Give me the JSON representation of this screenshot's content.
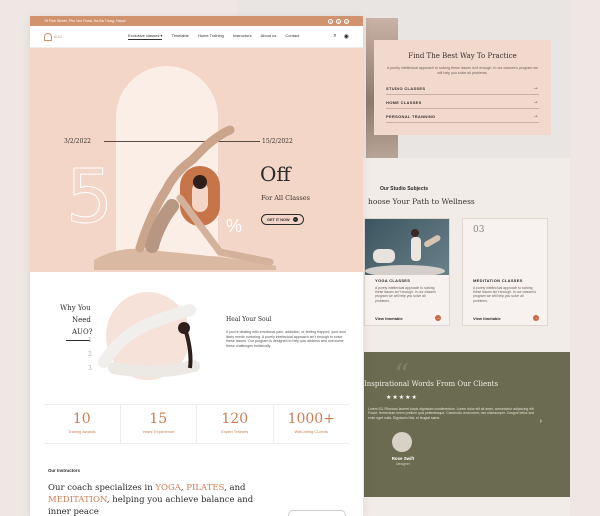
{
  "back": {
    "practice": {
      "title": "Find The Best Way To Practice",
      "text": "A purely intellectual approach to solving these issues isn't enough. In our classes's program we will help you solve all problems.",
      "rows": [
        {
          "label": "STUDIO CLASSES",
          "arrow": "→"
        },
        {
          "label": "HOME CLASSES",
          "arrow": "→"
        },
        {
          "label": "PERSONAL TRANNING",
          "arrow": "→"
        }
      ]
    },
    "studio": {
      "subtitle": "Our Studio Subjects",
      "title": "hoose Your Path to Wellness"
    },
    "cards": [
      {
        "num": "",
        "name": "YOGA CLASSES",
        "desc": "A purely intellectual approach to solving these issues isn't enough. In our classes program we will help you solve all problems.",
        "cta": "View timetable",
        "dot": "→"
      },
      {
        "num": "03",
        "name": "MEDITATION CLASSES",
        "desc": "A purely intellectual approach to solving these issues isn't enough. In our classes's program we will help you solve all problems.",
        "cta": "View timetable",
        "dot": "→"
      }
    ],
    "quotes": {
      "title": "Inspirational Words From Our Clients",
      "stars": "★★★★★",
      "text": "Lorem ISL Rhoncus laoreet turpis dignissim condimentum. Lorem dolor elit sit amet, consectetur adipiscing elit. Fusce, fermentum lorem pretium quis pellentesque. Commodo urna lorem, nec ullamcorper. Congue tellus sed enim eget nulla. Dignissim Nisl, et feugiat sama.",
      "name": "Rose Swift",
      "role": "Designer",
      "next": "›",
      "quote_mark": "“"
    }
  },
  "topbar": {
    "address": "78 Fine Street, Pho Vue Rural, Ha Ba Trung, Hanoi",
    "social": [
      "f",
      "●",
      "◎"
    ]
  },
  "nav": {
    "logo": "AUO",
    "items": [
      "Exclusive classes ▾",
      "Timetable",
      "Home Training",
      "Instructors",
      "About us",
      "Contact"
    ],
    "search_icon": "⌕",
    "user_icon": "◉"
  },
  "hero": {
    "date_start": "3/2/2022",
    "date_end": "15/2/2022",
    "big_number": "5",
    "percent": "%",
    "off": "Off",
    "off_sub": "For All Classes",
    "cta": "GET IT NOW",
    "cta_icon": "→"
  },
  "heal": {
    "why_lines": [
      "Why You",
      "Need",
      "AUO?"
    ],
    "nums": [
      "1",
      "2",
      "3"
    ],
    "title": "Heal Your Soul",
    "text": "If you're dealing with emotional pain, addiction, or feeling trapped, your soul likely needs nurturing. A purely intellectual approach isn't enough to solve these issues. Our program is designed to help you address and overcome these challenges holistically."
  },
  "stats": [
    {
      "n": "10",
      "l": "Traning Awards"
    },
    {
      "n": "15",
      "l": "Years' Experience"
    },
    {
      "n": "120",
      "l": "Expert Trainers"
    },
    {
      "n": "1000+",
      "l": "Well-being CLients"
    }
  ],
  "instructors": {
    "label": "Our Instructors",
    "coach_a": "Our coach specializes in ",
    "yoga": "YOGA",
    "comma": ", ",
    "pilates": "PILATES",
    "coach_b": ", and ",
    "meditation": "MEDITATION",
    "coach_c": ", helping you achieve balance and inner peace"
  },
  "colors": {
    "accent": "#cc7c54",
    "peach": "#f3d6c8",
    "olive": "#6a6b51",
    "topbar": "#d0936d"
  }
}
